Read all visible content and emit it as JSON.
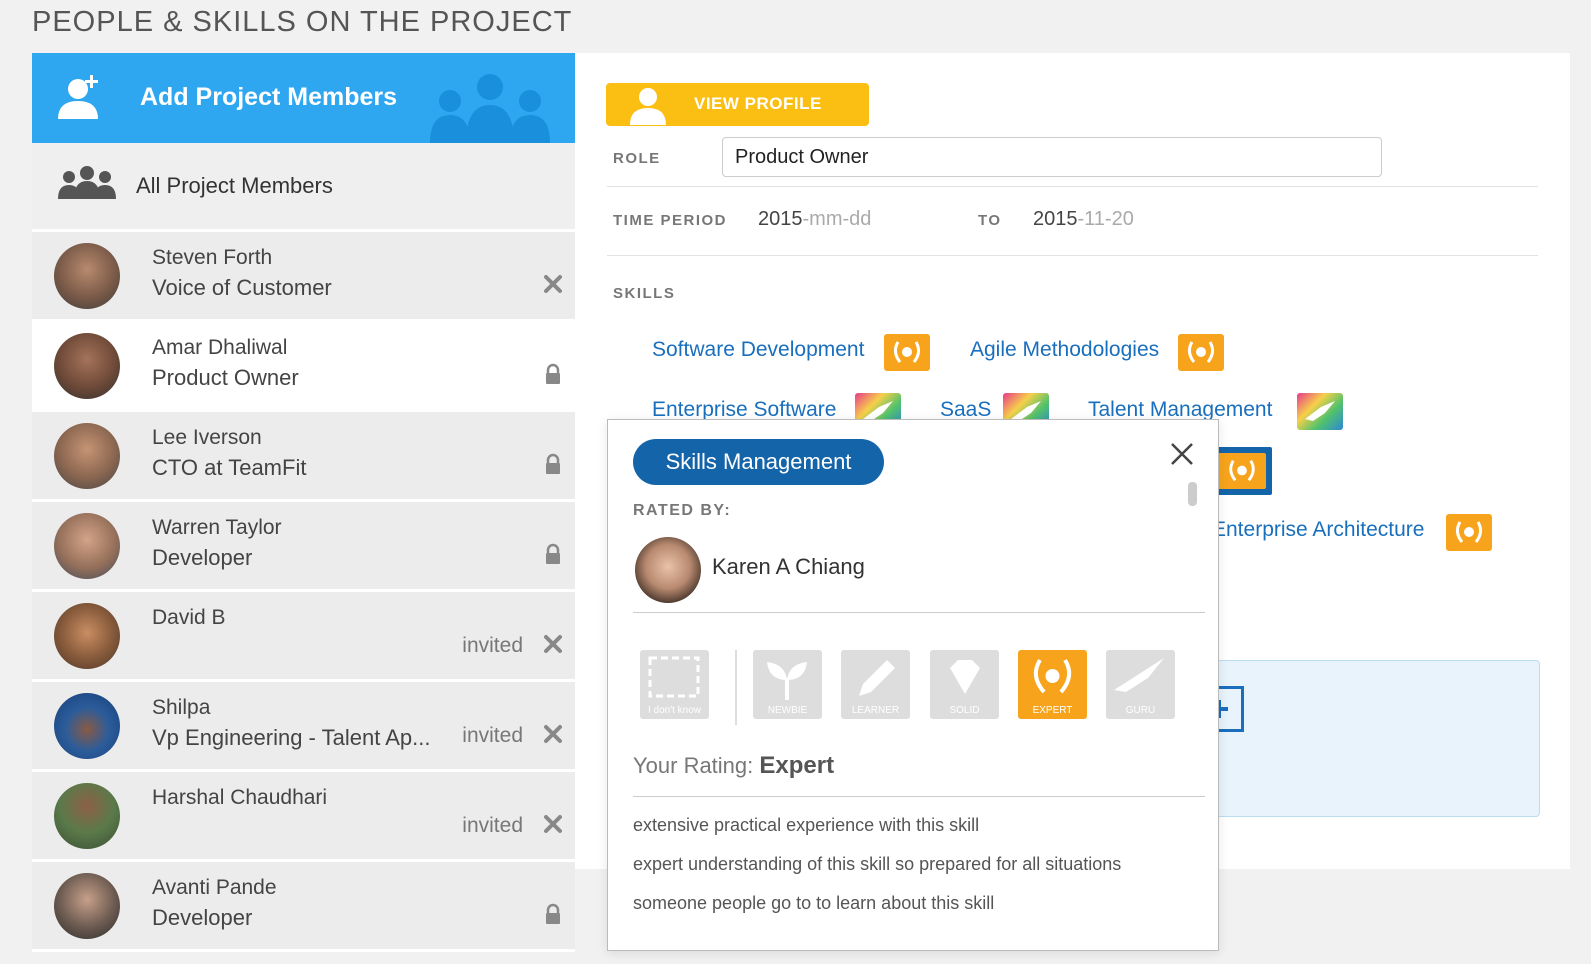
{
  "page_title": "PEOPLE & SKILLS ON THE PROJECT",
  "sidebar": {
    "add_label": "Add Project Members",
    "all_label": "All Project Members",
    "members": [
      {
        "name": "Steven Forth",
        "role": "Voice of Customer",
        "status": "",
        "action": "remove-icon"
      },
      {
        "name": "Amar Dhaliwal",
        "role": "Product Owner",
        "status": "",
        "action": "lock-icon"
      },
      {
        "name": "Lee Iverson",
        "role": "CTO at TeamFit",
        "status": "",
        "action": "lock-icon"
      },
      {
        "name": "Warren Taylor",
        "role": "Developer",
        "status": "",
        "action": "lock-icon"
      },
      {
        "name": "David B",
        "role": "",
        "status": "invited",
        "action": "remove-icon"
      },
      {
        "name": "Shilpa",
        "role": "Vp Engineering - Talent Ap...",
        "status": "invited",
        "action": "remove-icon"
      },
      {
        "name": "Harshal Chaudhari",
        "role": "",
        "status": "invited",
        "action": "remove-icon"
      },
      {
        "name": "Avanti Pande",
        "role": "Developer",
        "status": "",
        "action": "lock-icon"
      }
    ]
  },
  "profile": {
    "view_profile_label": "VIEW PROFILE",
    "role_label": "ROLE",
    "role_value": "Product Owner",
    "time_period_label": "TIME PERIOD",
    "start_year": "2015",
    "start_rest": "-mm-dd",
    "to_label": "TO",
    "end_year": "2015",
    "end_rest": "-11-20",
    "skills_label": "SKILLS",
    "skills": [
      {
        "name": "Software Development",
        "badge": "expert"
      },
      {
        "name": "Agile Methodologies",
        "badge": "expert"
      },
      {
        "name": "Enterprise Software",
        "badge": "bird"
      },
      {
        "name": "SaaS",
        "badge": "bird"
      },
      {
        "name": "Talent Management",
        "badge": "bird"
      },
      {
        "name": "Enterprise Architecture",
        "badge": "expert"
      }
    ]
  },
  "popup": {
    "title": "Skills Management",
    "rated_by_label": "RATED BY:",
    "rater_name": "Karen A Chiang",
    "levels": [
      {
        "label": "I don't know",
        "icon": "unknown-icon"
      },
      {
        "label": "NEWBIE",
        "icon": "sprout-icon"
      },
      {
        "label": "LEARNER",
        "icon": "pencil-icon"
      },
      {
        "label": "SOLID",
        "icon": "diamond-icon"
      },
      {
        "label": "EXPERT",
        "icon": "laurel-icon"
      },
      {
        "label": "GURU",
        "icon": "eagle-icon"
      }
    ],
    "selected_level": "EXPERT",
    "your_rating_label": "Your Rating:",
    "your_rating_value": "Expert",
    "descriptions": [
      "extensive practical experience with this skill",
      "expert understanding of this skill so prepared for all situations",
      "someone people go to to learn about this skill"
    ]
  },
  "colors": {
    "accent_blue": "#2fa6f0",
    "pill_blue": "#1464aa",
    "button_yellow": "#fbbf14",
    "expert_orange": "#f7a41c",
    "link_blue": "#1a6fbd"
  }
}
